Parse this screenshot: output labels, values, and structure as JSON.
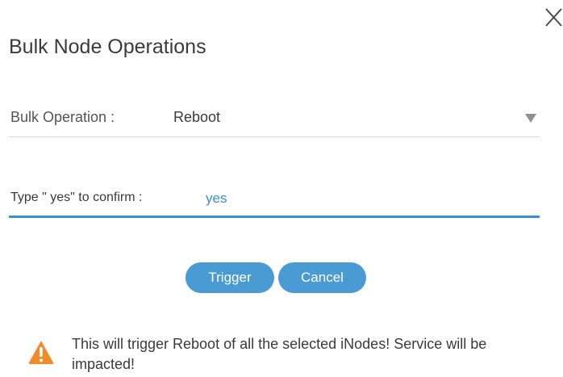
{
  "dialog": {
    "title": "Bulk Node Operations",
    "close_icon": "close-icon"
  },
  "bulk_operation": {
    "label": "Bulk Operation :",
    "selected_value": "Reboot",
    "dropdown_icon": "caret-down-icon"
  },
  "confirm": {
    "label": "Type \" yes\"  to confirm :",
    "value": "yes"
  },
  "buttons": {
    "trigger_label": "Trigger",
    "cancel_label": "Cancel"
  },
  "warning": {
    "icon": "warning-icon",
    "text": "This will trigger Reboot of all the selected iNodes! Service will be impacted!"
  },
  "colors": {
    "accent": "#3b8fcc",
    "button": "#4a9ad4",
    "warning": "#f28c28"
  }
}
